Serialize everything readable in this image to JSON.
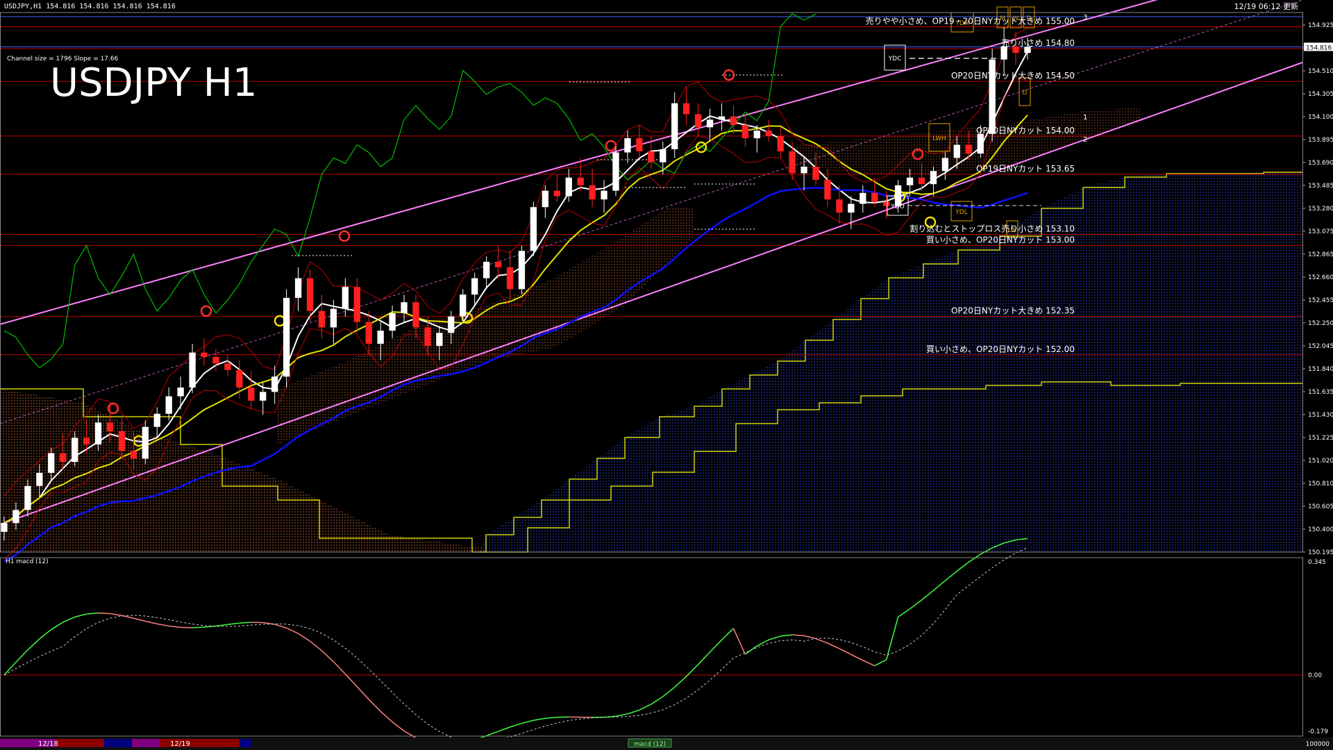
{
  "header": {
    "symbol_info": "USDJPY,H1  154.816 154.816 154.816 154.816",
    "updated": "12/19 06:12 更新",
    "title": "USDJPY H1",
    "channel_info": "Channel size = 1796 Slope = 17.66"
  },
  "price_axis": {
    "ticks": [
      "154.925",
      "154.720",
      "154.510",
      "154.305",
      "154.100",
      "153.895",
      "153.690",
      "153.485",
      "153.280",
      "153.075",
      "152.865",
      "152.660",
      "152.455",
      "152.250",
      "152.045",
      "151.840",
      "151.635",
      "151.430",
      "151.225",
      "151.020",
      "150.810",
      "150.605",
      "150.400",
      "150.195"
    ],
    "current": "154.816"
  },
  "macd": {
    "label": "H1  macd (12)",
    "ticks": [
      "0.345",
      "0.00",
      "-0.179"
    ]
  },
  "annotations": [
    {
      "text": "売りやや小さめ、OP19・20日NYカット大きめ 155.00",
      "price": 155.0
    },
    {
      "text": "売り小さめ 154.80",
      "price": 154.8
    },
    {
      "text": "OP20日NYカット大きめ 154.50",
      "price": 154.5
    },
    {
      "text": "OP20日NYカット 154.00",
      "price": 154.0
    },
    {
      "text": "OP19日NYカット 153.65",
      "price": 153.65
    },
    {
      "text": "割り込むとストップロス売り小さめ 153.10",
      "price": 153.1
    },
    {
      "text": "買い小さめ、OP20日NYカット 153.00",
      "price": 153.0
    },
    {
      "text": "OP20日NYカット大きめ 152.35",
      "price": 152.35
    },
    {
      "text": "買い小さめ、OP20日NYカット 152.00",
      "price": 152.0
    }
  ],
  "box_labels": [
    "YDH",
    "YDC",
    "YDO",
    "YDL",
    "LWH",
    "M",
    "W",
    "D",
    "D",
    "LW"
  ],
  "channel_marks": [
    "3",
    "1",
    "2"
  ],
  "bottom_bar": {
    "date1": "12/18",
    "date2": "12/19",
    "indicator": "macd (12)",
    "right_value": "100000"
  },
  "colors": {
    "bg": "#000000",
    "bull": "#ffffff",
    "bear": "#ff2020",
    "level": "#c00000",
    "channel": "#ff80ff",
    "ma_fast": "#ffffff",
    "ma_mid": "#e6e600",
    "ma_slow": "#1010ff",
    "chikou": "#00c000",
    "macd_up": "#40ff40",
    "macd_down": "#ff8080",
    "cloud_red": "#ff8040",
    "cloud_blue": "#3050ff"
  },
  "chart_data": {
    "type": "candlestick",
    "title": "USDJPY H1",
    "ylim": [
      150.195,
      155.2
    ],
    "ohlc": [
      [
        150.38,
        150.52,
        150.3,
        150.46
      ],
      [
        150.46,
        150.65,
        150.4,
        150.58
      ],
      [
        150.58,
        150.86,
        150.52,
        150.8
      ],
      [
        150.8,
        151.0,
        150.7,
        150.92
      ],
      [
        150.92,
        151.15,
        150.85,
        151.1
      ],
      [
        151.1,
        151.28,
        150.95,
        151.02
      ],
      [
        151.02,
        151.3,
        150.98,
        151.24
      ],
      [
        151.24,
        151.4,
        151.1,
        151.18
      ],
      [
        151.18,
        151.45,
        151.12,
        151.38
      ],
      [
        151.38,
        151.55,
        151.2,
        151.3
      ],
      [
        151.3,
        151.45,
        151.05,
        151.12
      ],
      [
        151.12,
        151.3,
        150.95,
        151.05
      ],
      [
        151.05,
        151.4,
        151.0,
        151.34
      ],
      [
        151.34,
        151.52,
        151.25,
        151.46
      ],
      [
        151.46,
        151.7,
        151.4,
        151.62
      ],
      [
        151.62,
        151.8,
        151.5,
        151.7
      ],
      [
        151.7,
        152.1,
        151.65,
        152.02
      ],
      [
        152.02,
        152.15,
        151.9,
        151.98
      ],
      [
        151.98,
        152.05,
        151.85,
        151.92
      ],
      [
        151.92,
        152.0,
        151.8,
        151.86
      ],
      [
        151.86,
        151.95,
        151.6,
        151.7
      ],
      [
        151.7,
        151.85,
        151.5,
        151.58
      ],
      [
        151.58,
        151.75,
        151.45,
        151.66
      ],
      [
        151.66,
        151.9,
        151.55,
        151.8
      ],
      [
        151.8,
        152.6,
        151.7,
        152.52
      ],
      [
        152.52,
        152.8,
        152.4,
        152.7
      ],
      [
        152.7,
        152.78,
        152.3,
        152.4
      ],
      [
        152.4,
        152.55,
        152.15,
        152.25
      ],
      [
        152.25,
        152.5,
        152.1,
        152.42
      ],
      [
        152.42,
        152.7,
        152.35,
        152.62
      ],
      [
        152.62,
        152.7,
        152.2,
        152.3
      ],
      [
        152.3,
        152.4,
        152.0,
        152.1
      ],
      [
        152.1,
        152.3,
        151.95,
        152.22
      ],
      [
        152.22,
        152.45,
        152.15,
        152.38
      ],
      [
        152.38,
        152.55,
        152.3,
        152.48
      ],
      [
        152.48,
        152.55,
        152.15,
        152.25
      ],
      [
        152.25,
        152.35,
        152.0,
        152.08
      ],
      [
        152.08,
        152.25,
        151.95,
        152.2
      ],
      [
        152.2,
        152.4,
        152.1,
        152.35
      ],
      [
        152.35,
        152.6,
        152.3,
        152.55
      ],
      [
        152.55,
        152.75,
        152.45,
        152.7
      ],
      [
        152.7,
        152.9,
        152.6,
        152.85
      ],
      [
        152.85,
        153.0,
        152.7,
        152.8
      ],
      [
        152.8,
        152.95,
        152.5,
        152.6
      ],
      [
        152.6,
        153.0,
        152.55,
        152.95
      ],
      [
        152.95,
        153.4,
        152.9,
        153.35
      ],
      [
        153.35,
        153.55,
        153.25,
        153.5
      ],
      [
        153.5,
        153.65,
        153.4,
        153.45
      ],
      [
        153.45,
        153.7,
        153.4,
        153.62
      ],
      [
        153.62,
        153.8,
        153.5,
        153.55
      ],
      [
        153.55,
        153.7,
        153.35,
        153.42
      ],
      [
        153.42,
        153.6,
        153.3,
        153.5
      ],
      [
        153.5,
        153.9,
        153.45,
        153.85
      ],
      [
        153.85,
        154.05,
        153.75,
        153.98
      ],
      [
        153.98,
        154.1,
        153.8,
        153.86
      ],
      [
        153.86,
        154.0,
        153.7,
        153.76
      ],
      [
        153.76,
        153.95,
        153.65,
        153.88
      ],
      [
        153.88,
        154.4,
        153.8,
        154.3
      ],
      [
        154.3,
        154.45,
        154.1,
        154.2
      ],
      [
        154.2,
        154.3,
        154.0,
        154.08
      ],
      [
        154.08,
        154.25,
        153.95,
        154.15
      ],
      [
        154.15,
        154.3,
        154.05,
        154.18
      ],
      [
        154.18,
        154.28,
        154.02,
        154.1
      ],
      [
        154.1,
        154.2,
        153.9,
        153.98
      ],
      [
        153.98,
        154.1,
        153.85,
        154.05
      ],
      [
        154.05,
        154.15,
        153.95,
        154.0
      ],
      [
        154.0,
        154.08,
        153.8,
        153.86
      ],
      [
        153.86,
        153.95,
        153.6,
        153.66
      ],
      [
        153.66,
        153.8,
        153.5,
        153.72
      ],
      [
        153.72,
        153.85,
        153.55,
        153.6
      ],
      [
        153.6,
        153.7,
        153.35,
        153.42
      ],
      [
        153.42,
        153.55,
        153.2,
        153.3
      ],
      [
        153.3,
        153.45,
        153.15,
        153.38
      ],
      [
        153.38,
        153.55,
        153.3,
        153.48
      ],
      [
        153.48,
        153.62,
        153.35,
        153.4
      ],
      [
        153.4,
        153.5,
        153.25,
        153.36
      ],
      [
        153.36,
        153.6,
        153.3,
        153.55
      ],
      [
        153.55,
        153.7,
        153.45,
        153.62
      ],
      [
        153.62,
        153.75,
        153.5,
        153.56
      ],
      [
        153.56,
        153.72,
        153.45,
        153.68
      ],
      [
        153.68,
        153.85,
        153.6,
        153.8
      ],
      [
        153.8,
        154.0,
        153.7,
        153.92
      ],
      [
        153.92,
        154.05,
        153.78,
        153.84
      ],
      [
        153.84,
        154.1,
        153.8,
        154.02
      ],
      [
        154.02,
        154.8,
        153.95,
        154.7
      ],
      [
        154.7,
        155.0,
        154.55,
        154.82
      ],
      [
        154.82,
        154.95,
        154.65,
        154.76
      ],
      [
        154.76,
        154.9,
        154.7,
        154.816
      ]
    ]
  }
}
